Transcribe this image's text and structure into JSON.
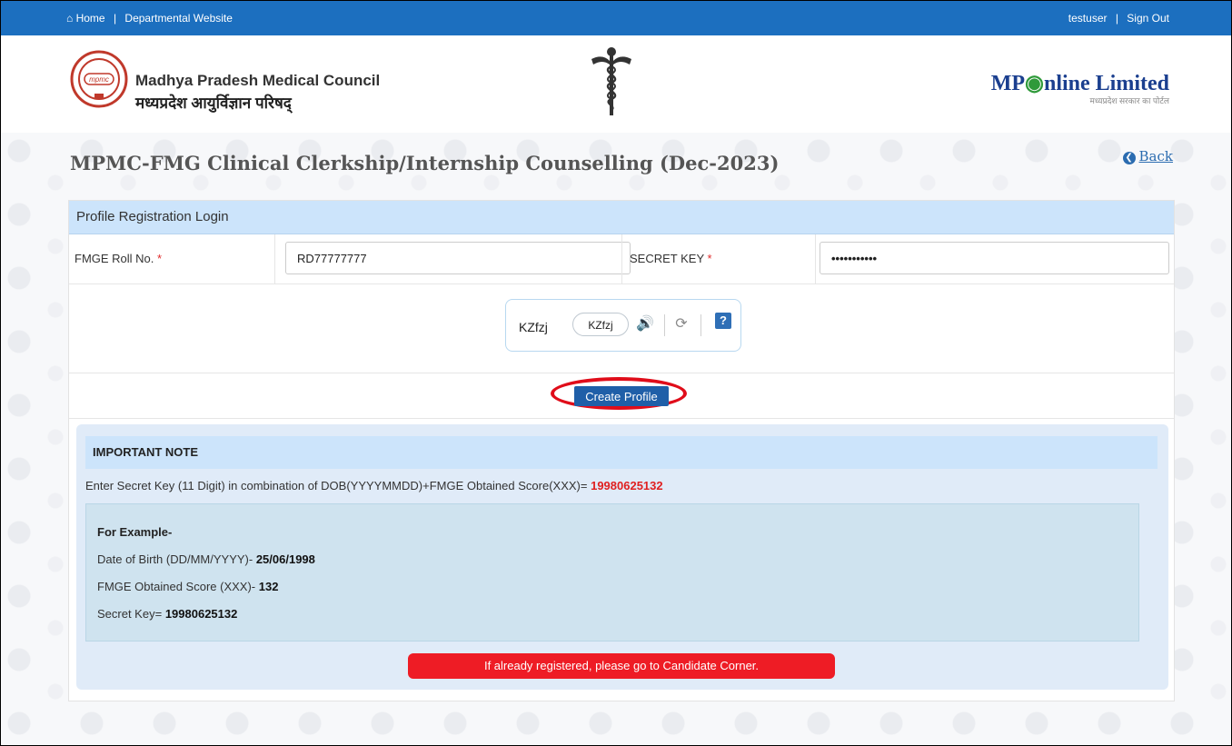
{
  "topbar": {
    "home_label": "Home",
    "departmental_label": "Departmental Website",
    "separator": "|",
    "user": "testuser",
    "signout_label": "Sign Out"
  },
  "header": {
    "council_name_en": "Madhya Pradesh Medical Council",
    "council_name_hi": "मध्यप्रदेश आयुर्विज्ञान परिषद्",
    "mponline_brand_prefix": "MP",
    "mponline_brand_suffix": "nline Limited",
    "mponline_tagline": "मध्यप्रदेश सरकार का पोर्टल"
  },
  "page": {
    "title": "MPMC-FMG Clinical Clerkship/Internship Counselling (Dec-2023)",
    "back_label": "Back"
  },
  "form": {
    "heading": "Profile Registration Login",
    "roll_label": "FMGE Roll No.",
    "roll_value": "RD77777777",
    "secret_label": "SECRET KEY",
    "secret_value": "•••••••••••",
    "required_mark": "*",
    "captcha_text": "KZfzj",
    "captcha_input_value": "KZfzj",
    "submit_label": "Create Profile"
  },
  "note": {
    "heading": "IMPORTANT NOTE",
    "line": "Enter Secret Key (11 Digit) in combination of DOB(YYYYMMDD)+FMGE Obtained Score(XXX)=",
    "line_value": "19980625132",
    "example_title": "For Example-",
    "dob_label": "Date of Birth (DD/MM/YYYY)-",
    "dob_value": "25/06/1998",
    "score_label": "FMGE Obtained Score (XXX)-",
    "score_value": "132",
    "key_label": "Secret Key=",
    "key_value": "19980625132",
    "registered_msg": "If already registered, please go to Candidate Corner."
  },
  "colors": {
    "topbar": "#1c6fbf",
    "panel_head": "#cce4fb",
    "button": "#1f5fa8",
    "alert": "#ee1c25",
    "highlight_ring": "#e00d1a"
  }
}
